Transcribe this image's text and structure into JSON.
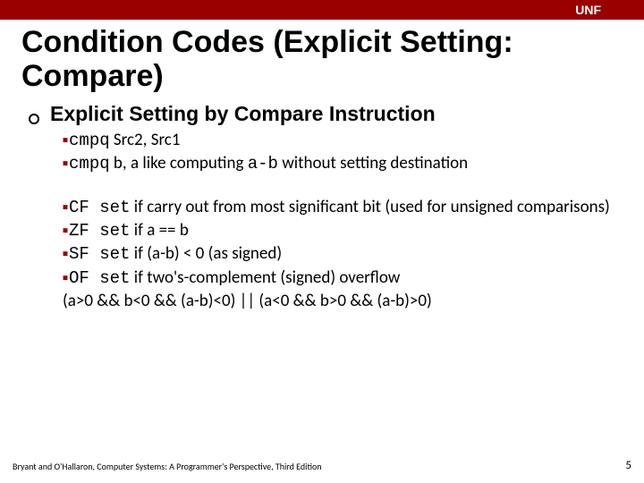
{
  "topbar": {
    "label": "UNF"
  },
  "title": "Condition Codes (Explicit Setting: Compare)",
  "heading": "Explicit Setting by Compare Instruction",
  "group1": {
    "a_code": "cmpq",
    "a_rest": " Src2, Src1",
    "b_code1": "cmpq",
    "b_mid1": " b, a",
    "b_plain1": " like computing ",
    "b_code2": "a-b",
    "b_plain2": " without setting destination"
  },
  "group2": {
    "cf_b": "CF set",
    "cf_t": " if carry out from most significant bit (used for unsigned comparisons)",
    "zf_b": "ZF set",
    "zf_t": " if a == b",
    "sf_b": "SF set",
    "sf_t": " if (a-b) < 0 (as signed)",
    "of_b": "OF set",
    "of_t": " if two's-complement (signed) overflow",
    "of_line2": "(a>0 && b<0 && (a-b)<0) || (a<0 && b>0 && (a-b)>0)"
  },
  "footer": "Bryant and O'Hallaron, Computer Systems: A Programmer's Perspective, Third Edition",
  "page": "5"
}
